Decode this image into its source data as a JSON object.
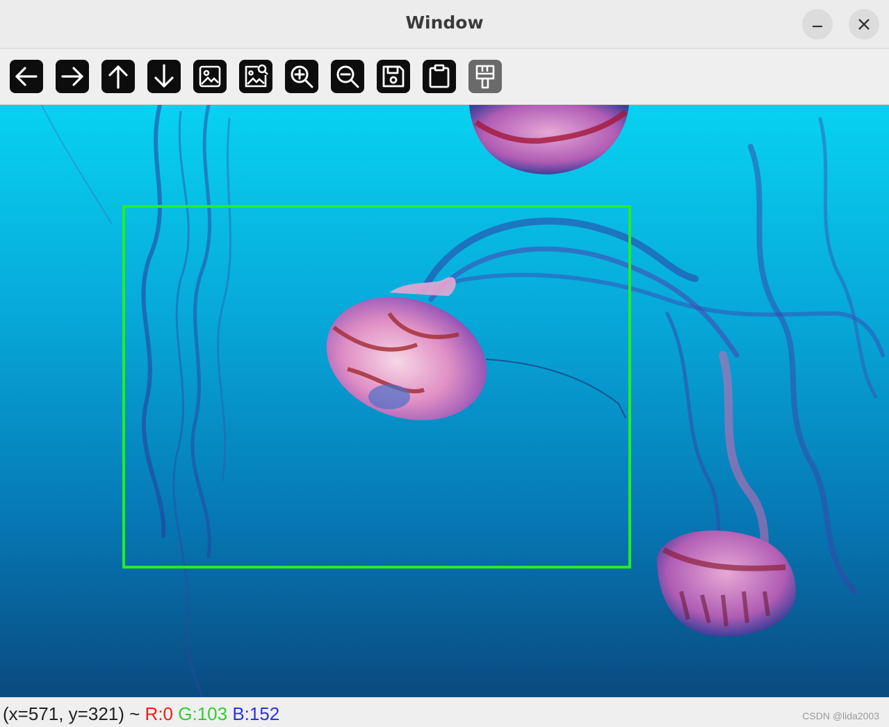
{
  "window": {
    "title": "Window"
  },
  "toolbar": {
    "buttons": [
      {
        "icon": "arrow-left-icon"
      },
      {
        "icon": "arrow-right-icon"
      },
      {
        "icon": "arrow-up-icon"
      },
      {
        "icon": "arrow-down-icon"
      },
      {
        "icon": "image-icon"
      },
      {
        "icon": "image-search-icon"
      },
      {
        "icon": "zoom-in-icon"
      },
      {
        "icon": "zoom-out-icon"
      },
      {
        "icon": "save-icon"
      },
      {
        "icon": "clipboard-icon"
      },
      {
        "icon": "properties-icon"
      }
    ]
  },
  "status": {
    "coords": "(x=571, y=321) ~",
    "r": "R:0",
    "g": "G:103",
    "b": "B:152",
    "colors": {
      "r": "#e8201a",
      "g": "#2ecf2e",
      "b": "#2a33e0"
    }
  },
  "watermark": "CSDN @lida2003",
  "colors": {
    "roi_box": "#22ee22",
    "water_top": "#08cfee",
    "water_bottom": "#0a4f86"
  }
}
